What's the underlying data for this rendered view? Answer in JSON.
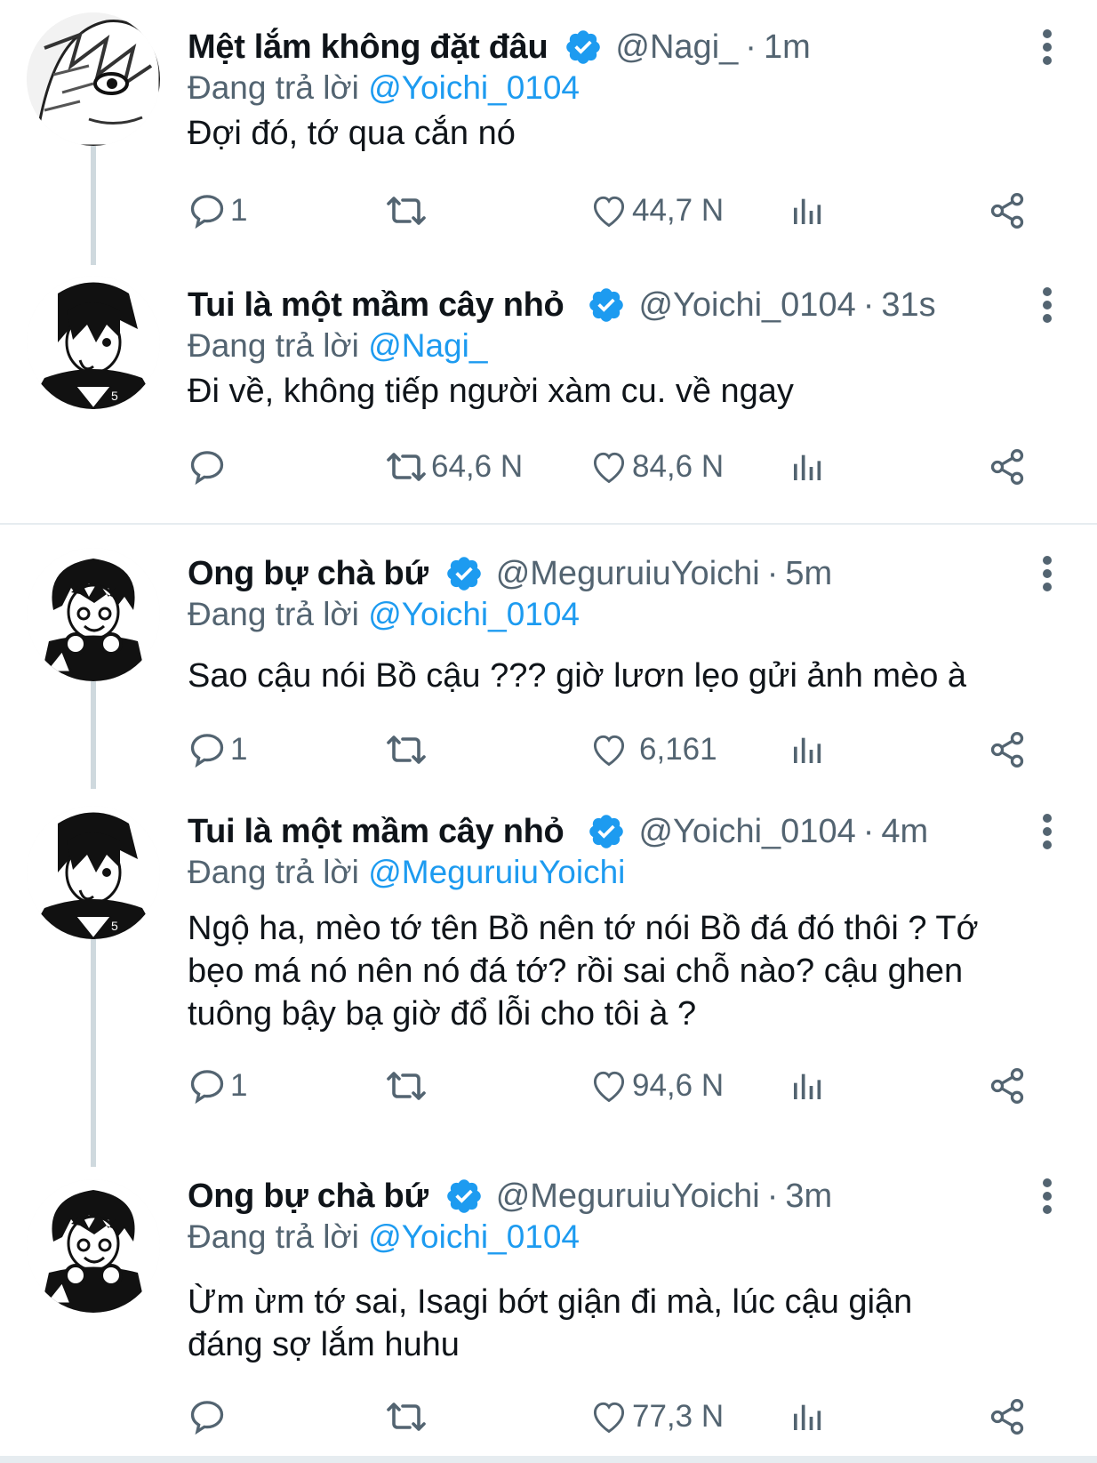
{
  "replying_prefix": "Đang trả lời",
  "tweets": [
    {
      "name": "Mệt lắm không đặt đâu",
      "handle": "@Nagi_",
      "separator": "·",
      "time": "1m",
      "reply_to": "@Yoichi_0104",
      "text": "Đợi đó, tớ qua cắn nó",
      "replies": "1",
      "retweets": "",
      "likes": "44,7 N",
      "avatar": "avatar-white-hair"
    },
    {
      "name": "Tui là một mầm cây nhỏ",
      "handle": "@Yoichi_0104",
      "separator": "·",
      "time": "31s",
      "reply_to": "@Nagi_",
      "text": "Đi về, không tiếp người xàm cu. về ngay",
      "replies": "",
      "retweets": "64,6 N",
      "likes": "84,6 N",
      "avatar": "avatar-dark-hair"
    },
    {
      "name": "Ong bự chà bứ",
      "handle": "@MeguruiuYoichi",
      "separator": "·",
      "time": "5m",
      "reply_to": "@Yoichi_0104",
      "text": "Sao cậu nói Bồ cậu ??? giờ lươn lẹo gửi ảnh mèo à",
      "replies": "1",
      "retweets": "",
      "likes": "6,161",
      "avatar": "avatar-headphones"
    },
    {
      "name": "Tui là một mầm cây nhỏ",
      "handle": "@Yoichi_0104",
      "separator": "·",
      "time": "4m",
      "reply_to": "@MeguruiuYoichi",
      "text_lines": [
        "Ngộ ha, mèo tớ tên Bồ nên tớ nói Bồ đá đó thôi ? Tớ",
        "bẹo má nó nên nó đá tớ? rồi sai chỗ nào? cậu ghen",
        "tuông bậy bạ giờ đổ lỗi cho tôi à ?"
      ],
      "replies": "1",
      "retweets": "",
      "likes": "94,6 N",
      "avatar": "avatar-dark-hair"
    },
    {
      "name": "Ong bự chà bứ",
      "handle": "@MeguruiuYoichi",
      "separator": "·",
      "time": "3m",
      "reply_to": "@Yoichi_0104",
      "text_lines": [
        "Ừm ừm tớ sai, Isagi bớt giận đi mà, lúc cậu giận",
        "đáng sợ lắm huhu"
      ],
      "replies": "",
      "retweets": "",
      "likes": "77,3 N",
      "avatar": "avatar-headphones"
    }
  ],
  "colors": {
    "verified": "#1d9bf0",
    "mention": "#1d9bf0",
    "secondary_text": "#536471",
    "thread_line": "#cfd9de"
  }
}
